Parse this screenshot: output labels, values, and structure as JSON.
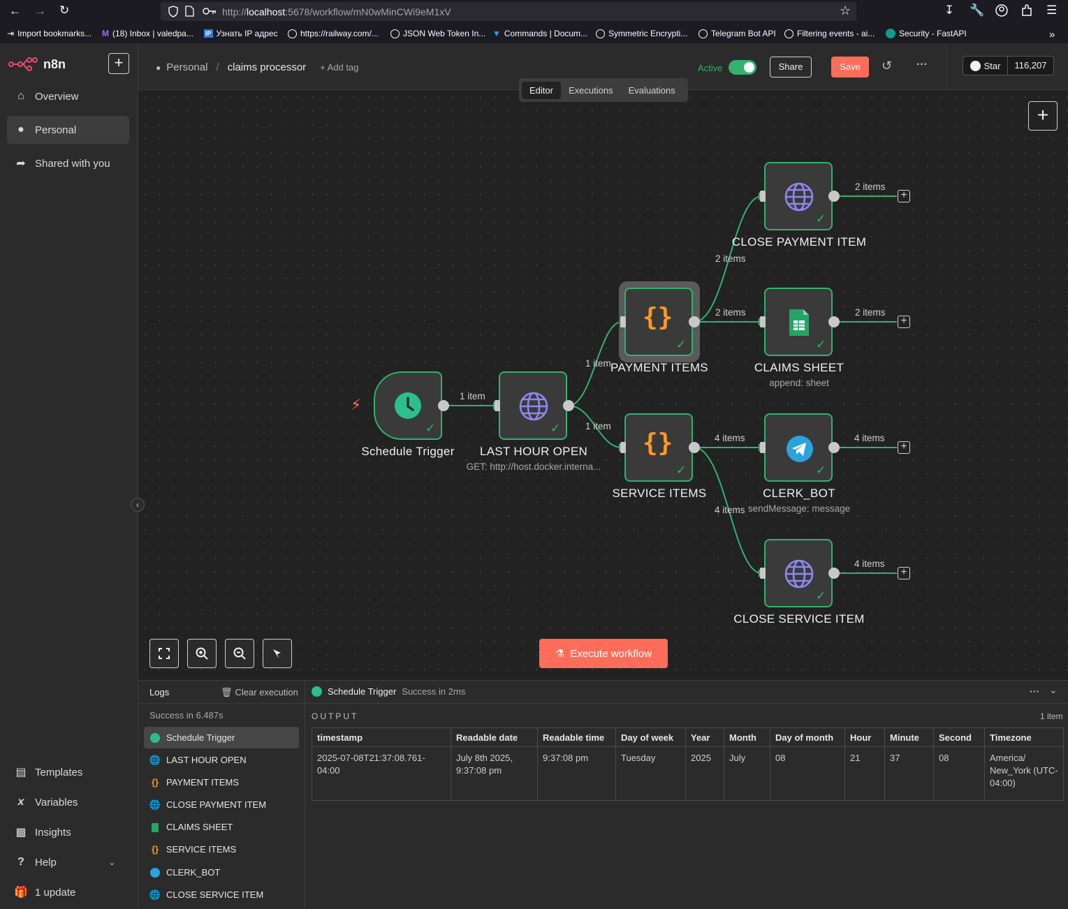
{
  "browser": {
    "url_prefix": "http://",
    "url_host": "localhost",
    "url_rest": ":5678/workflow/mN0wMinCWi9eM1xV",
    "bookmarks": [
      {
        "label": "Import bookmarks..."
      },
      {
        "label": "(18) Inbox | valedpa..."
      },
      {
        "label": "Узнать IP адрес"
      },
      {
        "label": "https://railway.com/..."
      },
      {
        "label": "JSON Web Token In..."
      },
      {
        "label": "Commands | Docum..."
      },
      {
        "label": "Symmetric Encrypti..."
      },
      {
        "label": "Telegram Bot API"
      },
      {
        "label": "Filtering events - ai..."
      },
      {
        "label": "Security - FastAPI"
      }
    ]
  },
  "sidebar": {
    "brand": "n8n",
    "nav": [
      {
        "label": "Overview",
        "icon": "home-icon"
      },
      {
        "label": "Personal",
        "icon": "user-icon"
      },
      {
        "label": "Shared with you",
        "icon": "share-icon"
      }
    ],
    "bottom": [
      {
        "label": "Templates",
        "icon": "templates-icon"
      },
      {
        "label": "Variables",
        "icon": "variables-icon"
      },
      {
        "label": "Insights",
        "icon": "insights-icon"
      },
      {
        "label": "Help",
        "icon": "help-icon"
      },
      {
        "label": "1 update",
        "icon": "gift-icon"
      }
    ]
  },
  "header": {
    "breadcrumb_owner": "Personal",
    "breadcrumb_sep": "/",
    "workflow_name": "claims processor",
    "add_tag": "+ Add tag",
    "active_label": "Active",
    "share_label": "Share",
    "save_label": "Save",
    "github_star": "Star",
    "github_count": "116,207",
    "tabs": [
      "Editor",
      "Executions",
      "Evaluations"
    ]
  },
  "canvas": {
    "nodes": {
      "schedule": {
        "label": "Schedule Trigger"
      },
      "lasthour": {
        "label": "LAST HOUR OPEN",
        "sub": "GET: http://host.docker.interna..."
      },
      "payment": {
        "label": "PAYMENT ITEMS"
      },
      "service": {
        "label": "SERVICE ITEMS"
      },
      "closepay": {
        "label": "CLOSE PAYMENT ITEM"
      },
      "claims": {
        "label": "CLAIMS SHEET",
        "sub": "append: sheet"
      },
      "clerk": {
        "label": "CLERK_BOT",
        "sub": "sendMessage: message"
      },
      "closeserv": {
        "label": "CLOSE SERVICE ITEM"
      }
    },
    "edges": {
      "e1": "1 item",
      "e2": "1 item",
      "e3": "1 item",
      "e4": "2 items",
      "e5": "2 items",
      "e6": "4 items",
      "e7": "4 items",
      "o1": "2 items",
      "o2": "2 items",
      "o3": "4 items",
      "o4": "4 items"
    },
    "execute_label": "Execute workflow"
  },
  "logs": {
    "title": "Logs",
    "clear": "Clear execution",
    "summary": "Success in 6.487s",
    "items": [
      {
        "label": "Schedule Trigger",
        "icon": "clock-icon"
      },
      {
        "label": "LAST HOUR OPEN",
        "icon": "globe-icon"
      },
      {
        "label": "PAYMENT ITEMS",
        "icon": "code-icon"
      },
      {
        "label": "CLOSE PAYMENT ITEM",
        "icon": "globe-icon"
      },
      {
        "label": "CLAIMS SHEET",
        "icon": "sheets-icon"
      },
      {
        "label": "SERVICE ITEMS",
        "icon": "code-icon"
      },
      {
        "label": "CLERK_BOT",
        "icon": "telegram-icon"
      },
      {
        "label": "CLOSE SERVICE ITEM",
        "icon": "globe-icon"
      }
    ],
    "selected_node": "Schedule Trigger",
    "selected_status": "Success in 2ms",
    "output_label": "OUTPUT",
    "item_count": "1 item",
    "columns": [
      "timestamp",
      "Readable date",
      "Readable time",
      "Day of week",
      "Year",
      "Month",
      "Day of month",
      "Hour",
      "Minute",
      "Second",
      "Timezone"
    ],
    "row": [
      "2025-07-08T21:37:08.761-04:00",
      "July 8th 2025, 9:37:08 pm",
      "9:37:08 pm",
      "Tuesday",
      "2025",
      "July",
      "08",
      "21",
      "37",
      "08",
      "America/ New_York (UTC-04:00)"
    ]
  },
  "colors": {
    "accent": "#ea4b71",
    "success": "#2fb36f",
    "save": "#ff6d5a",
    "edge": "#2fb36f"
  }
}
